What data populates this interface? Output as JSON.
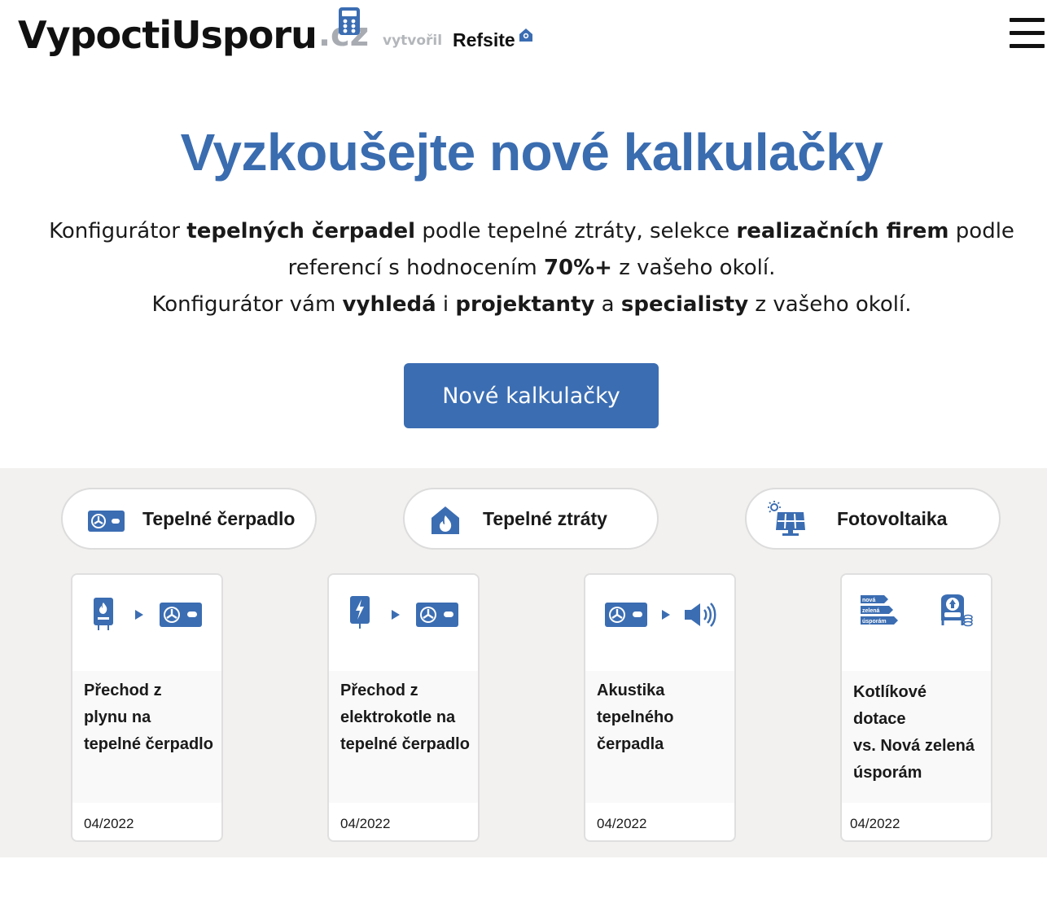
{
  "header": {
    "logo_main": "VypoctiUsporu",
    "logo_tld": ".cz",
    "created_by": "vytvořil",
    "partner": "Refsite",
    "menu_icon": "hamburger-menu-icon"
  },
  "hero": {
    "title": "Vyzkoušejte nové kalkulačky",
    "line1_a": "Konfigurátor ",
    "line1_b": "tepelných čerpadel",
    "line1_c": " podle tepelné ztráty, selekce ",
    "line1_d": "realizačních firem",
    "line1_e": " podle",
    "line2_a": "referencí s hodnocením ",
    "line2_b": "70%+",
    "line2_c": " z vašeho okolí.",
    "line3_a": "Konfigurátor vám ",
    "line3_b": "vyhledá",
    "line3_c": " i ",
    "line3_d": "projektanty",
    "line3_e": " a ",
    "line3_f": "specialisty",
    "line3_g": " z vašeho okolí.",
    "button": "Nové kalkulačky"
  },
  "categories": [
    {
      "label": "Tepelné čerpadlo",
      "icon": "heat-pump-icon"
    },
    {
      "label": "Tepelné ztráty",
      "icon": "house-flame-icon"
    },
    {
      "label": "Fotovoltaika",
      "icon": "solar-panel-icon"
    }
  ],
  "cards": [
    {
      "title_lines": [
        "Přechod z",
        "plynu na",
        "tepelné čerpadlo"
      ],
      "date": "04/2022"
    },
    {
      "title_lines": [
        "Přechod z",
        "elektrokotle na",
        "tepelné čerpadlo"
      ],
      "date": "04/2022"
    },
    {
      "title_lines": [
        "Akustika",
        "tepelného",
        "čerpadla"
      ],
      "date": "04/2022"
    },
    {
      "title_lines": [
        "Kotlíkové",
        "dotace",
        "vs. Nová zelená",
        "úsporám"
      ],
      "date": "04/2022"
    }
  ],
  "card4_badge": [
    "nová",
    "zelená",
    "úsporám"
  ],
  "colors": {
    "accent": "#3b6db2",
    "title": "#3a6cb0",
    "section_bg": "#f2f1ef"
  }
}
